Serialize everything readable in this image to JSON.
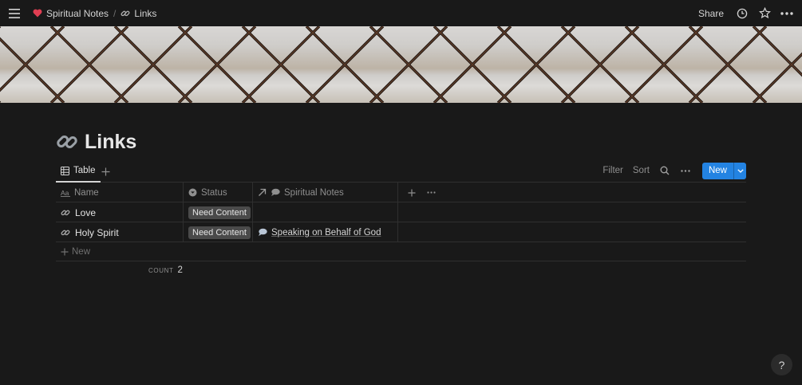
{
  "topbar": {
    "breadcrumbs": [
      {
        "label": "Spiritual Notes",
        "icon": "heart-icon"
      },
      {
        "label": "Links",
        "icon": "link-icon"
      }
    ],
    "separator": "/",
    "share_label": "Share"
  },
  "page": {
    "title": "Links",
    "title_icon": "link-icon"
  },
  "view": {
    "tab_label": "Table",
    "filter_label": "Filter",
    "sort_label": "Sort",
    "new_label": "New"
  },
  "table": {
    "columns": [
      {
        "label": "Name",
        "icon": "text-icon"
      },
      {
        "label": "Status",
        "icon": "status-icon"
      },
      {
        "label": "Spiritual Notes",
        "icon": "relation-icon"
      }
    ],
    "rows": [
      {
        "name": "Love",
        "status": "Need Content",
        "relation": ""
      },
      {
        "name": "Holy Spirit",
        "status": "Need Content",
        "relation": "Speaking on Behalf of God"
      }
    ],
    "new_row_label": "New",
    "count_label": "COUNT",
    "count_value": "2"
  },
  "help_label": "?",
  "colors": {
    "background": "#191919",
    "accent": "#2383e2",
    "badge": "#4a4a4a",
    "heart": "#e03e52"
  }
}
